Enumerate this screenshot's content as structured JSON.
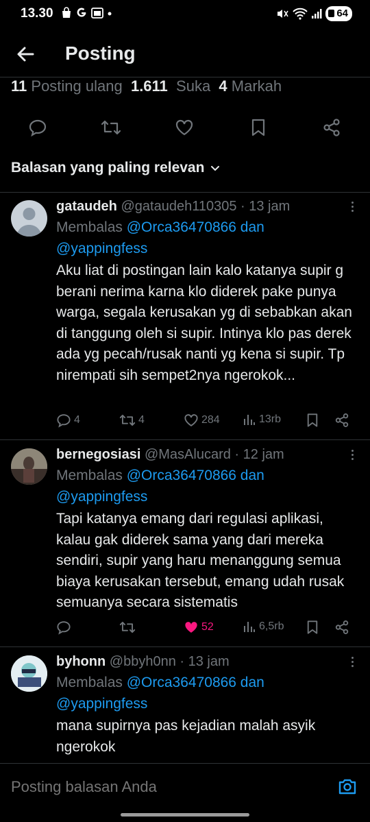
{
  "status": {
    "time": "13.30",
    "battery": "64"
  },
  "header": {
    "title": "Posting"
  },
  "stats": {
    "reposts_count": "11",
    "reposts_label": "Posting ulang",
    "likes_count": "1.611",
    "likes_label": "Suka",
    "bookmarks_count": "4",
    "bookmarks_label": "Markah"
  },
  "sort": {
    "label": "Balasan yang paling relevan"
  },
  "replies": [
    {
      "name": "gataudeh",
      "handle": "@gataudeh110305",
      "time": "13 jam",
      "reply_prefix": "Membalas",
      "mention": "@Orca36470866 dan @yappingfess",
      "text": "Aku liat di postingan lain kalo katanya supir g berani nerima karna klo diderek pake punya warga, segala kerusakan yg di sebabkan akan di tanggung oleh si supir. Intinya klo pas derek ada yg pecah/rusak nanti yg kena si supir. Tp nirempati sih sempet2nya ngerokok...",
      "replies": "4",
      "reposts": "4",
      "likes": "284",
      "views": "13rb",
      "liked": false
    },
    {
      "name": "bernegosiasi",
      "handle": "@MasAlucard",
      "time": "12 jam",
      "reply_prefix": "Membalas",
      "mention": "@Orca36470866 dan @yappingfess",
      "text": "Tapi katanya emang dari regulasi aplikasi, kalau gak diderek sama yang dari mereka sendiri, supir yang haru menanggung semua biaya kerusakan tersebut, emang udah rusak semuanya secara sistematis",
      "replies": "",
      "reposts": "",
      "likes": "52",
      "views": "6,5rb",
      "liked": true
    },
    {
      "name": "byhonn",
      "handle": "@bbyh0nn",
      "time": "13 jam",
      "reply_prefix": "Membalas",
      "mention": "@Orca36470866 dan @yappingfess",
      "text": "mana supirnya pas kejadian malah asyik ngerokok"
    }
  ],
  "composer": {
    "placeholder": "Posting balasan Anda"
  },
  "colors": {
    "accent": "#1d9bf0",
    "like": "#f91880",
    "muted": "#71767b",
    "text": "#e7e9ea",
    "divider": "#2f3336"
  },
  "icons": [
    "back-arrow-icon",
    "reply-icon",
    "repost-icon",
    "like-icon",
    "bookmark-icon",
    "share-icon",
    "chevron-down-icon",
    "more-icon",
    "views-icon",
    "camera-icon"
  ]
}
